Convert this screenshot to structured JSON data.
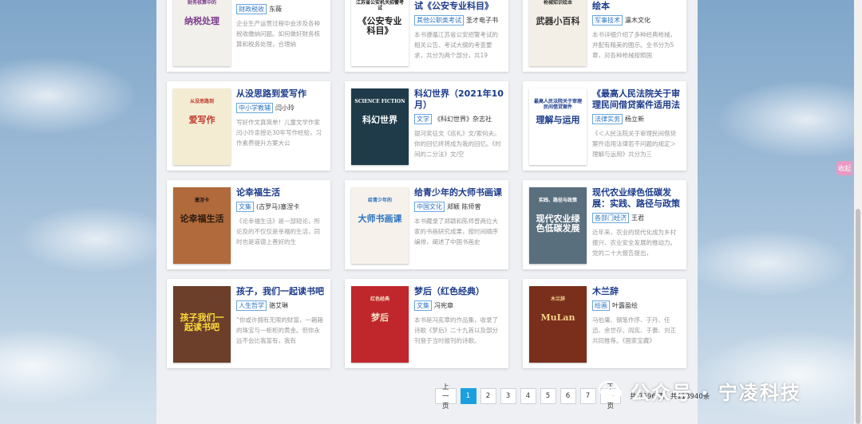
{
  "books": [
    {
      "title": "财务核算中的纳税处理",
      "tag": "财政税收",
      "author": "东薇",
      "desc": "企业生产运营过程中会涉及各种税收缴纳问题。如何做好财务核算和税务处理，合理纳",
      "cover": {
        "bg": "#f2f0ea",
        "fg": "#7b3d8f",
        "text": "纳税处理",
        "sub": "财务核算中的"
      }
    },
    {
      "title": "江苏省公安机关招警考试《公安专业科目》",
      "tag": "其他公职类考试",
      "author": "圣才电子书",
      "desc": "本书遵循江苏省公安招警考试的相关公告、考试大纲的考查要求，共分为两个部分，共19",
      "cover": {
        "bg": "#ffffff",
        "fg": "#222",
        "text": "《公安专业科目》",
        "sub": "江苏省公安机关招警考试"
      }
    },
    {
      "title": "武器小百科：枪械知识绘本",
      "tag": "军事技术",
      "author": "瀛木文化",
      "desc": "本书详细介绍了多种经典枪械，并配有精美的图示。全书分为5章，对各种枪械按照国",
      "cover": {
        "bg": "#f3efe6",
        "fg": "#333",
        "text": "武器小百科",
        "sub": "枪械知识绘本"
      }
    },
    {
      "title": "从没思路到爱写作",
      "tag": "中小学教辅",
      "author": "闫小玲",
      "desc": "写好作文真简单！儿童文学作家闫小玲亲授近30年写作经验，习作素养提升方案大公",
      "cover": {
        "bg": "#f4ecd2",
        "fg": "#c0392b",
        "text": "爱写作",
        "sub": "从没思路到"
      }
    },
    {
      "title": "科幻世界（2021年10月）",
      "tag": "文学",
      "author": "《科幻世界》杂志社",
      "desc": "银河奖征文《巡礼》文/索何夫。你的回忆终将成为我的回忆。《时间的二分法》文/空",
      "cover": {
        "bg": "#1f3b4a",
        "fg": "#ffffff",
        "text": "科幻世界",
        "sub": "SCIENCE FICTION"
      }
    },
    {
      "title": "《最高人民法院关于审理民间借贷案件适用法律若干问题的规定》理解与运用",
      "tag": "法律实务",
      "author": "杨立新",
      "desc": "《＜人民法院关于审理民间借贷案件适用法律若干问题的规定＞理解与运用》共分为三",
      "cover": {
        "bg": "#ffffff",
        "fg": "#1a3a8a",
        "text": "理解与运用",
        "sub": "最高人民法院关于审理民间借贷案件"
      }
    },
    {
      "title": "论幸福生活",
      "tag": "文集",
      "author": "(古罗马)塞涅卡",
      "desc": "《论幸福生活》是一部短论，所论及的不仅仅是幸福的生活，同时也是道德上善好的生",
      "cover": {
        "bg": "#b06a3b",
        "fg": "#2a1a10",
        "text": "论幸福生活",
        "sub": "塞涅卡"
      }
    },
    {
      "title": "给青少年的大师书画课",
      "tag": "中国文化",
      "author": "郑颖 陈师曾",
      "desc": "本书藏录了郑颖和陈师曾两位大家的书画研究成果，按时间顺序编排，阐述了中国书画史",
      "cover": {
        "bg": "#f6f1ea",
        "fg": "#2a74c0",
        "text": "大师书画课",
        "sub": "给青少年的"
      }
    },
    {
      "title": "现代农业绿色低碳发展：实践、路径与政策",
      "tag": "各部门经济",
      "author": "王君",
      "desc": "近年来，农业的现代化成为乡村振兴、农业安全发展的推动力。党的二十大报告提出，",
      "cover": {
        "bg": "#5a6f7e",
        "fg": "#ffffff",
        "text": "现代农业绿色低碳发展",
        "sub": "实践、路径与政策"
      }
    },
    {
      "title": "孩子，我们一起读书吧",
      "tag": "人生哲学",
      "author": "骆艾琳",
      "desc": "“你或许拥有无限的财富，一箱箱的珠宝与一柜柜的黄金。但你永远不会比我富有，我有",
      "cover": {
        "bg": "#6b3f2a",
        "fg": "#ffde3a",
        "text": "孩子我们一起读书吧",
        "sub": ""
      }
    },
    {
      "title": "梦后（红色经典）",
      "tag": "文集",
      "author": "冯宪章",
      "desc": "本书是冯宪章的作品集，收录了诗歌《梦后》二十九首以及部分刊登于当时报刊的诗歌。",
      "cover": {
        "bg": "#c0272d",
        "fg": "#f6e4c8",
        "text": "梦后",
        "sub": "红色经典"
      }
    },
    {
      "title": "木兰辞",
      "tag": "绘画",
      "author": "叶露盈绘",
      "desc": "马伯庸、钢笔作序、于丹、任迅、余世存、阎宪、于蕾、刘正共同推荐。《国家宝藏》",
      "cover": {
        "bg": "#7a2e1c",
        "fg": "#f5d38a",
        "text": "MuLan",
        "sub": "木兰辞"
      }
    }
  ],
  "pagination": {
    "prev": "上一页",
    "next": "下一页",
    "pages": [
      "1",
      "2",
      "3",
      "4",
      "5",
      "6",
      "7"
    ],
    "current": "1",
    "total_pages": "共 7596 页",
    "total_items": "共113940条"
  },
  "watermark": "公众号 · 宁凌科技",
  "side_tab": "收起"
}
